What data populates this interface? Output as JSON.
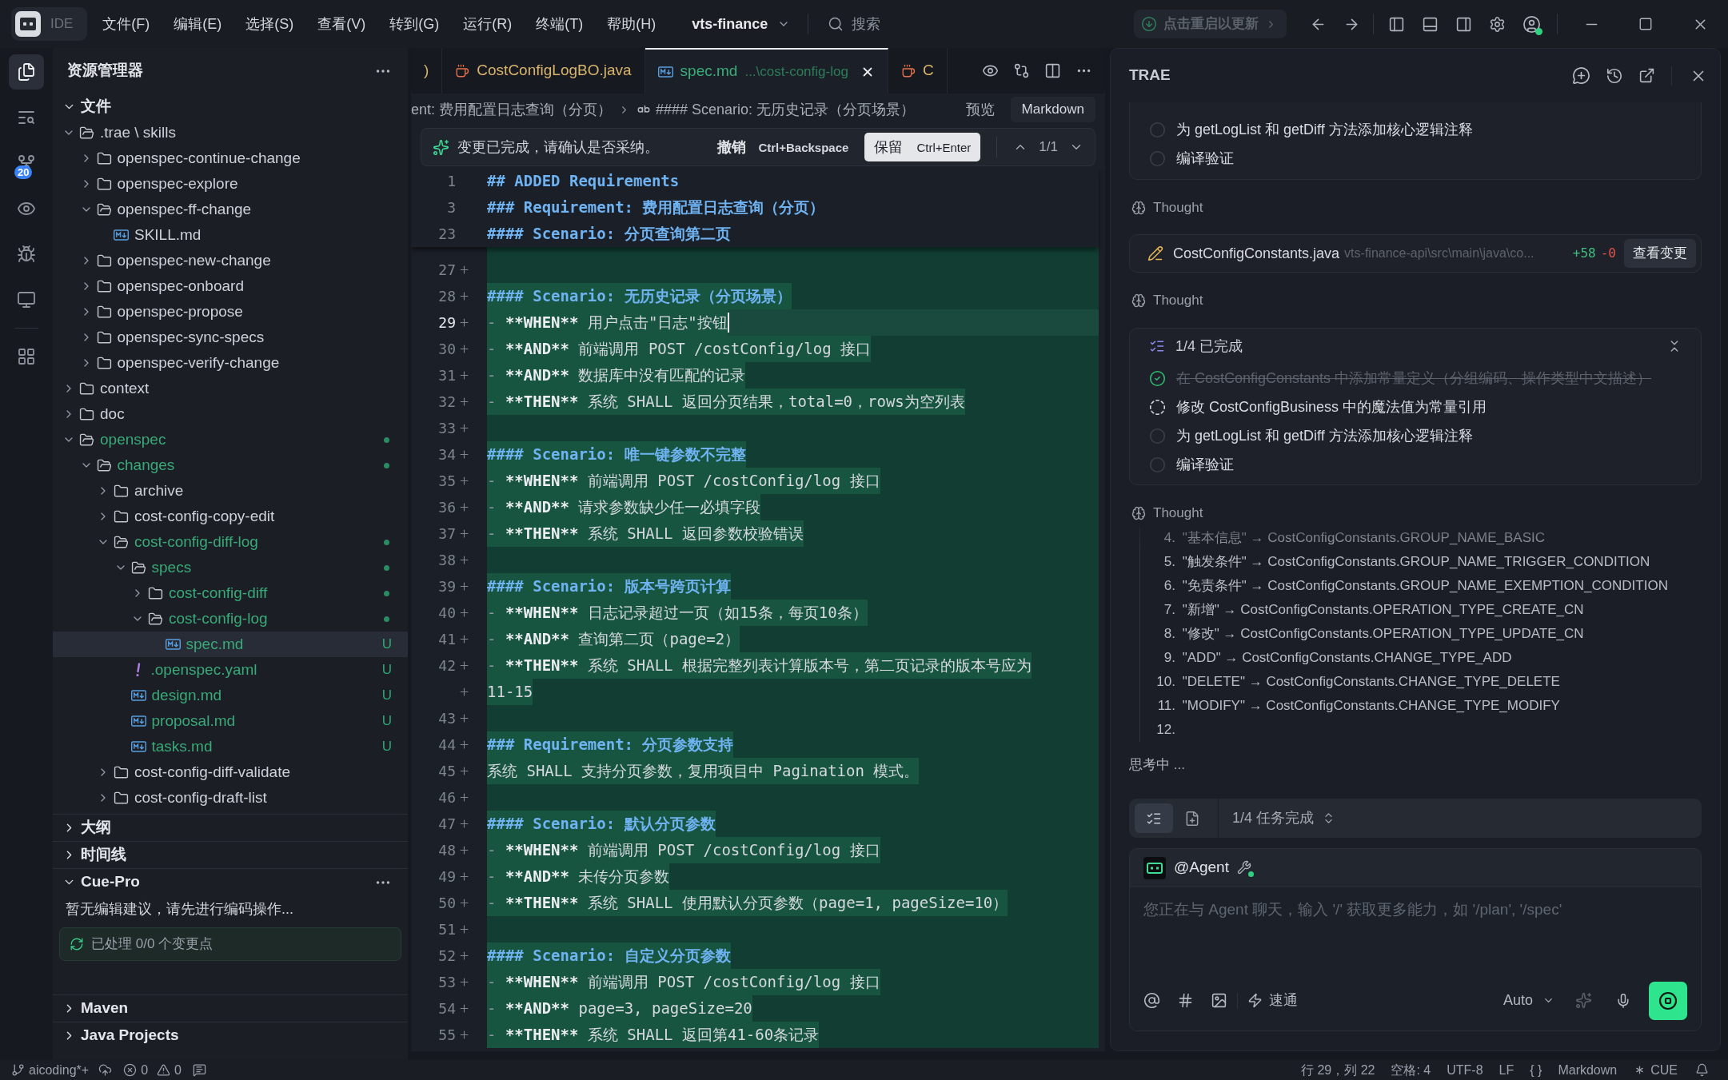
{
  "title_bar": {
    "badge": "IDE",
    "menus": [
      "文件(F)",
      "编辑(E)",
      "选择(S)",
      "查看(V)",
      "转到(G)",
      "运行(R)",
      "终端(T)",
      "帮助(H)"
    ],
    "project": "vts-finance",
    "search": {
      "placeholder": "搜索"
    },
    "update_button": "点击重启以更新"
  },
  "activity_bar": [
    {
      "kind": "explorer",
      "selected": true
    },
    {
      "kind": "search",
      "selected": false
    },
    {
      "kind": "source-control",
      "selected": false,
      "badge": "20"
    },
    {
      "kind": "preview",
      "selected": false
    },
    {
      "kind": "debug",
      "selected": false
    },
    {
      "kind": "remote",
      "selected": false
    },
    {
      "kind": "extensions",
      "selected": false
    }
  ],
  "sidebar": {
    "title": "资源管理器",
    "explorer": {
      "title": "文件",
      "expanded": true,
      "tree": [
        {
          "name": ".trae \\ skills",
          "kind": "folder",
          "expanded": true,
          "changed": false,
          "selected": false,
          "children": [
            {
              "name": "openspec-continue-change",
              "kind": "folder",
              "expanded": false,
              "changed": false,
              "selected": false
            },
            {
              "name": "openspec-explore",
              "kind": "folder",
              "expanded": false,
              "changed": false,
              "selected": false
            },
            {
              "name": "openspec-ff-change",
              "kind": "folder",
              "expanded": true,
              "changed": false,
              "selected": false,
              "children": [
                {
                  "name": "SKILL.md",
                  "kind": "markdown",
                  "changed": false,
                  "selected": false
                }
              ]
            },
            {
              "name": "openspec-new-change",
              "kind": "folder",
              "expanded": false,
              "changed": false,
              "selected": false
            },
            {
              "name": "openspec-onboard",
              "kind": "folder",
              "expanded": false,
              "changed": false,
              "selected": false
            },
            {
              "name": "openspec-propose",
              "kind": "folder",
              "expanded": false,
              "changed": false,
              "selected": false
            },
            {
              "name": "openspec-sync-specs",
              "kind": "folder",
              "expanded": false,
              "changed": false,
              "selected": false
            },
            {
              "name": "openspec-verify-change",
              "kind": "folder",
              "expanded": false,
              "changed": false,
              "selected": false
            }
          ]
        },
        {
          "name": "context",
          "kind": "folder",
          "expanded": false,
          "changed": false,
          "selected": false
        },
        {
          "name": "doc",
          "kind": "folder",
          "expanded": false,
          "changed": false,
          "selected": false
        },
        {
          "name": "openspec",
          "kind": "folder",
          "expanded": true,
          "changed": true,
          "selected": false,
          "children": [
            {
              "name": "changes",
              "kind": "folder",
              "expanded": true,
              "changed": true,
              "selected": false,
              "children": [
                {
                  "name": "archive",
                  "kind": "folder",
                  "expanded": false,
                  "changed": false,
                  "selected": false
                },
                {
                  "name": "cost-config-copy-edit",
                  "kind": "folder",
                  "expanded": false,
                  "changed": false,
                  "selected": false
                },
                {
                  "name": "cost-config-diff-log",
                  "kind": "folder",
                  "expanded": true,
                  "changed": true,
                  "selected": false,
                  "children": [
                    {
                      "name": "specs",
                      "kind": "folder",
                      "expanded": true,
                      "changed": true,
                      "selected": false,
                      "children": [
                        {
                          "name": "cost-config-diff",
                          "kind": "folder",
                          "expanded": false,
                          "changed": true,
                          "selected": false
                        },
                        {
                          "name": "cost-config-log",
                          "kind": "folder",
                          "expanded": true,
                          "changed": true,
                          "selected": false,
                          "children": [
                            {
                              "name": "spec.md",
                              "kind": "markdown",
                              "changed": true,
                              "selected": true,
                              "badge": "U"
                            }
                          ]
                        }
                      ]
                    },
                    {
                      "name": ".openspec.yaml",
                      "kind": "yaml",
                      "changed": true,
                      "selected": false,
                      "badge": "U"
                    },
                    {
                      "name": "design.md",
                      "kind": "markdown",
                      "changed": true,
                      "selected": false,
                      "badge": "U"
                    },
                    {
                      "name": "proposal.md",
                      "kind": "markdown",
                      "changed": true,
                      "selected": false,
                      "badge": "U"
                    },
                    {
                      "name": "tasks.md",
                      "kind": "markdown",
                      "changed": true,
                      "selected": false,
                      "badge": "U"
                    }
                  ]
                },
                {
                  "name": "cost-config-diff-validate",
                  "kind": "folder",
                  "expanded": false,
                  "changed": false,
                  "selected": false
                },
                {
                  "name": "cost-config-draft-list",
                  "kind": "folder",
                  "expanded": false,
                  "changed": false,
                  "selected": false
                }
              ]
            }
          ]
        }
      ]
    },
    "sections": [
      {
        "title": "大纲",
        "expanded": false
      },
      {
        "title": "时间线",
        "expanded": false
      },
      {
        "title": "Cue-Pro",
        "expanded": true,
        "message": "暂无编辑建议，请先进行编码操作...",
        "status": "已处理 0/0 个变更点"
      },
      {
        "title": "Maven",
        "expanded": false
      },
      {
        "title": "Java Projects",
        "expanded": false
      }
    ]
  },
  "editor": {
    "tabs": [
      {
        "label": ")",
        "kind": "text",
        "untracked": false,
        "selected": false
      },
      {
        "label": "CostConfigLogBO.java",
        "kind": "java",
        "untracked": false,
        "selected": false
      },
      {
        "label": "spec.md",
        "description": "...\\cost-config-log",
        "kind": "markdown",
        "untracked": true,
        "selected": true
      },
      {
        "label": "C",
        "kind": "java",
        "untracked": false,
        "selected": false
      }
    ],
    "breadcrumb": [
      {
        "kind": "section",
        "text": "ent: 费用配置日志查询（分页）"
      },
      {
        "kind": "string",
        "text": "#### Scenario: 无历史记录（分页场景）"
      }
    ],
    "preview": "预览",
    "language": "Markdown",
    "change_bar": {
      "message": "变更已完成，请确认是否采纳。",
      "undo": {
        "label": "撤销",
        "shortcut": "Ctrl+Backspace"
      },
      "keep": {
        "label": "保留",
        "shortcut": "Ctrl+Enter"
      },
      "counter": "1/1"
    },
    "sticky_lines": [
      {
        "number": "1",
        "added": false,
        "current": false,
        "tokens": [
          {
            "kind": "heading",
            "text": "## ADDED Requirements"
          }
        ]
      },
      {
        "number": "3",
        "added": false,
        "current": false,
        "tokens": [
          {
            "kind": "heading",
            "text": "### Requirement: 费用配置日志查询（分页）"
          }
        ]
      },
      {
        "number": "23",
        "added": false,
        "current": false,
        "tokens": [
          {
            "kind": "heading",
            "text": "#### Scenario: 分页查询第二页"
          }
        ]
      }
    ],
    "lines": [
      {
        "number": "27",
        "added": true,
        "current": false
      },
      {
        "number": "28",
        "added": true,
        "current": false,
        "tokens": [
          {
            "kind": "heading",
            "text": "#### Scenario: 无历史记录（分页场景）"
          }
        ]
      },
      {
        "number": "29",
        "added": true,
        "current": true,
        "tokens": [
          {
            "kind": "bullet",
            "text": "-"
          },
          {
            "kind": "bold",
            "text": "**WHEN**"
          },
          {
            "kind": "text",
            "text": "用户点击\"日志\"按钮"
          }
        ]
      },
      {
        "number": "30",
        "added": true,
        "current": false,
        "tokens": [
          {
            "kind": "bullet",
            "text": "-"
          },
          {
            "kind": "bold",
            "text": "**AND**"
          },
          {
            "kind": "text",
            "text": "前端调用 POST /costConfig/log 接口"
          }
        ]
      },
      {
        "number": "31",
        "added": true,
        "current": false,
        "tokens": [
          {
            "kind": "bullet",
            "text": "-"
          },
          {
            "kind": "bold",
            "text": "**AND**"
          },
          {
            "kind": "text",
            "text": "数据库中没有匹配的记录"
          }
        ]
      },
      {
        "number": "32",
        "added": true,
        "current": false,
        "tokens": [
          {
            "kind": "bullet",
            "text": "-"
          },
          {
            "kind": "bold",
            "text": "**THEN**"
          },
          {
            "kind": "text",
            "text": "系统 SHALL 返回分页结果，total=0，rows为空列表"
          }
        ]
      },
      {
        "number": "33",
        "added": true,
        "current": false
      },
      {
        "number": "34",
        "added": true,
        "current": false,
        "tokens": [
          {
            "kind": "heading",
            "text": "#### Scenario: 唯一键参数不完整"
          }
        ]
      },
      {
        "number": "35",
        "added": true,
        "current": false,
        "tokens": [
          {
            "kind": "bullet",
            "text": "-"
          },
          {
            "kind": "bold",
            "text": "**WHEN**"
          },
          {
            "kind": "text",
            "text": "前端调用 POST /costConfig/log 接口"
          }
        ]
      },
      {
        "number": "36",
        "added": true,
        "current": false,
        "tokens": [
          {
            "kind": "bullet",
            "text": "-"
          },
          {
            "kind": "bold",
            "text": "**AND**"
          },
          {
            "kind": "text",
            "text": "请求参数缺少任一必填字段"
          }
        ]
      },
      {
        "number": "37",
        "added": true,
        "current": false,
        "tokens": [
          {
            "kind": "bullet",
            "text": "-"
          },
          {
            "kind": "bold",
            "text": "**THEN**"
          },
          {
            "kind": "text",
            "text": "系统 SHALL 返回参数校验错误"
          }
        ]
      },
      {
        "number": "38",
        "added": true,
        "current": false
      },
      {
        "number": "39",
        "added": true,
        "current": false,
        "tokens": [
          {
            "kind": "heading",
            "text": "#### Scenario: 版本号跨页计算"
          }
        ]
      },
      {
        "number": "40",
        "added": true,
        "current": false,
        "tokens": [
          {
            "kind": "bullet",
            "text": "-"
          },
          {
            "kind": "bold",
            "text": "**WHEN**"
          },
          {
            "kind": "text",
            "text": "日志记录超过一页（如15条，每页10条）"
          }
        ]
      },
      {
        "number": "41",
        "added": true,
        "current": false,
        "tokens": [
          {
            "kind": "bullet",
            "text": "-"
          },
          {
            "kind": "bold",
            "text": "**AND**"
          },
          {
            "kind": "text",
            "text": "查询第二页（page=2）"
          }
        ]
      },
      {
        "number": "42",
        "added": true,
        "current": false,
        "tokens": [
          {
            "kind": "bullet",
            "text": "-"
          },
          {
            "kind": "bold",
            "text": "**THEN**"
          },
          {
            "kind": "text",
            "text": "系统 SHALL 根据完整列表计算版本号，第二页记录的版本号应为"
          }
        ],
        "continuation": "11-15"
      },
      {
        "number": "43",
        "added": true,
        "current": false
      },
      {
        "number": "44",
        "added": true,
        "current": false,
        "tokens": [
          {
            "kind": "heading",
            "text": "### Requirement: 分页参数支持"
          }
        ]
      },
      {
        "number": "45",
        "added": true,
        "current": false,
        "tokens": [
          {
            "kind": "text",
            "text": "系统 SHALL 支持分页参数，复用项目中 Pagination 模式。"
          }
        ]
      },
      {
        "number": "46",
        "added": true,
        "current": false
      },
      {
        "number": "47",
        "added": true,
        "current": false,
        "tokens": [
          {
            "kind": "heading",
            "text": "#### Scenario: 默认分页参数"
          }
        ]
      },
      {
        "number": "48",
        "added": true,
        "current": false,
        "tokens": [
          {
            "kind": "bullet",
            "text": "-"
          },
          {
            "kind": "bold",
            "text": "**WHEN**"
          },
          {
            "kind": "text",
            "text": "前端调用 POST /costConfig/log 接口"
          }
        ]
      },
      {
        "number": "49",
        "added": true,
        "current": false,
        "tokens": [
          {
            "kind": "bullet",
            "text": "-"
          },
          {
            "kind": "bold",
            "text": "**AND**"
          },
          {
            "kind": "text",
            "text": "未传分页参数"
          }
        ]
      },
      {
        "number": "50",
        "added": true,
        "current": false,
        "tokens": [
          {
            "kind": "bullet",
            "text": "-"
          },
          {
            "kind": "bold",
            "text": "**THEN**"
          },
          {
            "kind": "text",
            "text": "系统 SHALL 使用默认分页参数（page=1, pageSize=10）"
          }
        ]
      },
      {
        "number": "51",
        "added": true,
        "current": false
      },
      {
        "number": "52",
        "added": true,
        "current": false,
        "tokens": [
          {
            "kind": "heading",
            "text": "#### Scenario: 自定义分页参数"
          }
        ]
      },
      {
        "number": "53",
        "added": true,
        "current": false,
        "tokens": [
          {
            "kind": "bullet",
            "text": "-"
          },
          {
            "kind": "bold",
            "text": "**WHEN**"
          },
          {
            "kind": "text",
            "text": "前端调用 POST /costConfig/log 接口"
          }
        ]
      },
      {
        "number": "54",
        "added": true,
        "current": false,
        "tokens": [
          {
            "kind": "bullet",
            "text": "-"
          },
          {
            "kind": "bold",
            "text": "**AND**"
          },
          {
            "kind": "text",
            "text": "page=3, pageSize=20"
          }
        ]
      },
      {
        "number": "55",
        "added": true,
        "current": false,
        "tokens": [
          {
            "kind": "bullet",
            "text": "-"
          },
          {
            "kind": "bold",
            "text": "**THEN**"
          },
          {
            "kind": "text",
            "text": "系统 SHALL 返回第41-60条记录"
          }
        ]
      }
    ]
  },
  "assistant": {
    "title": "TRAE",
    "messages": [
      {
        "kind": "task_list_tail",
        "tasks": [
          {
            "text": "为 getLogList 和 getDiff 方法添加核心逻辑注释",
            "kind": "pending"
          },
          {
            "text": "编译验证",
            "kind": "pending"
          }
        ]
      },
      {
        "kind": "thought",
        "label": "Thought"
      },
      {
        "kind": "file_change",
        "file": "CostConfigConstants.java",
        "path": "vts-finance-api\\src\\main\\java\\co...",
        "added": "+58",
        "removed": "-0",
        "button": "查看变更"
      },
      {
        "kind": "thought",
        "label": "Thought"
      },
      {
        "kind": "task_list",
        "title": "1/4 已完成",
        "expanded": true,
        "tasks": [
          {
            "text": "在 CostConfigConstants 中添加常量定义（分组编码、操作类型中文描述）",
            "kind": "done"
          },
          {
            "text": "修改 CostConfigBusiness 中的魔法值为常量引用",
            "kind": "active"
          },
          {
            "text": "为 getLogList 和 getDiff 方法添加核心逻辑注释",
            "kind": "pending"
          },
          {
            "text": "编译验证",
            "kind": "pending"
          }
        ]
      },
      {
        "kind": "thought",
        "label": "Thought",
        "items": [
          {
            "number": "4.",
            "text": "\"基本信息\" → CostConfigConstants.GROUP_NAME_BASIC"
          },
          {
            "number": "5.",
            "text": "\"触发条件\" → CostConfigConstants.GROUP_NAME_TRIGGER_CONDITION"
          },
          {
            "number": "6.",
            "text": "\"免责条件\" → CostConfigConstants.GROUP_NAME_EXEMPTION_CONDITION"
          },
          {
            "number": "7.",
            "text": "\"新增\" → CostConfigConstants.OPERATION_TYPE_CREATE_CN"
          },
          {
            "number": "8.",
            "text": "\"修改\" → CostConfigConstants.OPERATION_TYPE_UPDATE_CN"
          },
          {
            "number": "9.",
            "text": "\"ADD\" → CostConfigConstants.CHANGE_TYPE_ADD"
          },
          {
            "number": "10.",
            "text": "\"DELETE\" → CostConfigConstants.CHANGE_TYPE_DELETE"
          },
          {
            "number": "11.",
            "text": "\"MODIFY\" → CostConfigConstants.CHANGE_TYPE_MODIFY"
          },
          {
            "number": "12."
          }
        ]
      },
      {
        "kind": "status",
        "text": "思考中 ..."
      }
    ],
    "task_bar": {
      "tabs": [
        {
          "kind": "checklist",
          "selected": true
        },
        {
          "kind": "document",
          "selected": false
        }
      ],
      "label": "1/4 任务完成"
    },
    "composer": {
      "agent": "@Agent",
      "placeholder": "您正在与 Agent 聊天，输入 '/' 获取更多能力，如 '/plan', '/spec'",
      "mode": "速通",
      "model": "Auto",
      "running": true
    }
  },
  "status_bar": {
    "branch": "aicoding*+",
    "errors": "0",
    "warnings": "0",
    "position": "行 29，列 22",
    "indent": "空格: 4",
    "encoding": "UTF-8",
    "eol": "LF",
    "brackets": "{ }",
    "language": "Markdown",
    "cue": "CUE"
  }
}
